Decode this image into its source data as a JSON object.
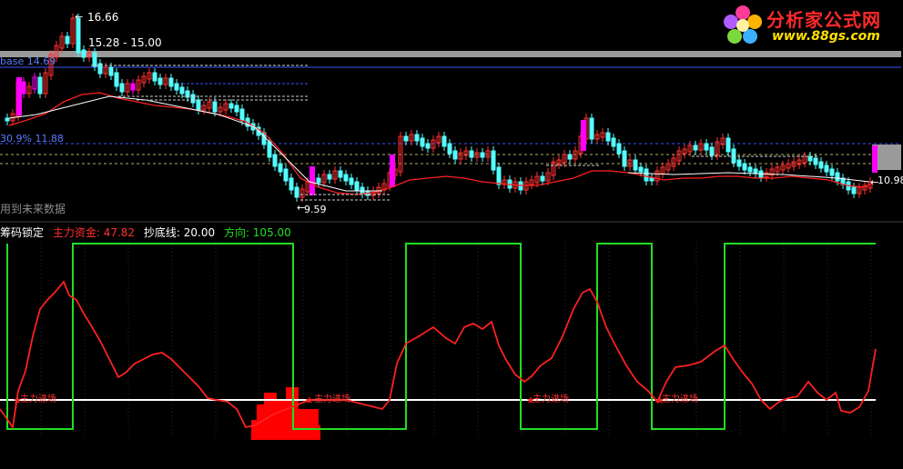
{
  "upper_panel": {
    "price_high_label": "16.66",
    "price_range_label": "15.28 - 15.00",
    "base_label": "base 14.69",
    "pct_label": "30.9% 11.88",
    "price_low_label": "9.59",
    "last_price_label": "10.98",
    "disclaimer": "用到未来数据"
  },
  "indicator_legend": {
    "name": "筹码锁定",
    "main_fund_label": "主力资金: 47.82",
    "bottom_line_label": "抄底线: 20.00",
    "direction_label": "方向: 105.00"
  },
  "signal_labels": [
    "主力进场",
    "主力进场",
    "主力进场",
    "主力进场"
  ],
  "logo": {
    "title": "分析家公式网",
    "url": "www.88gs.com"
  },
  "colors": {
    "background": "#000000",
    "up_candle": "#ff3030",
    "down_candle": "#54ffff",
    "magenta": "#ff00ff",
    "price_line": "#ff2020",
    "direction_line": "#22dd22",
    "base_line": "#ffffff",
    "grid": "#303070"
  },
  "icons": [
    "logo-flower-icon",
    "signal-star-icon"
  ]
}
